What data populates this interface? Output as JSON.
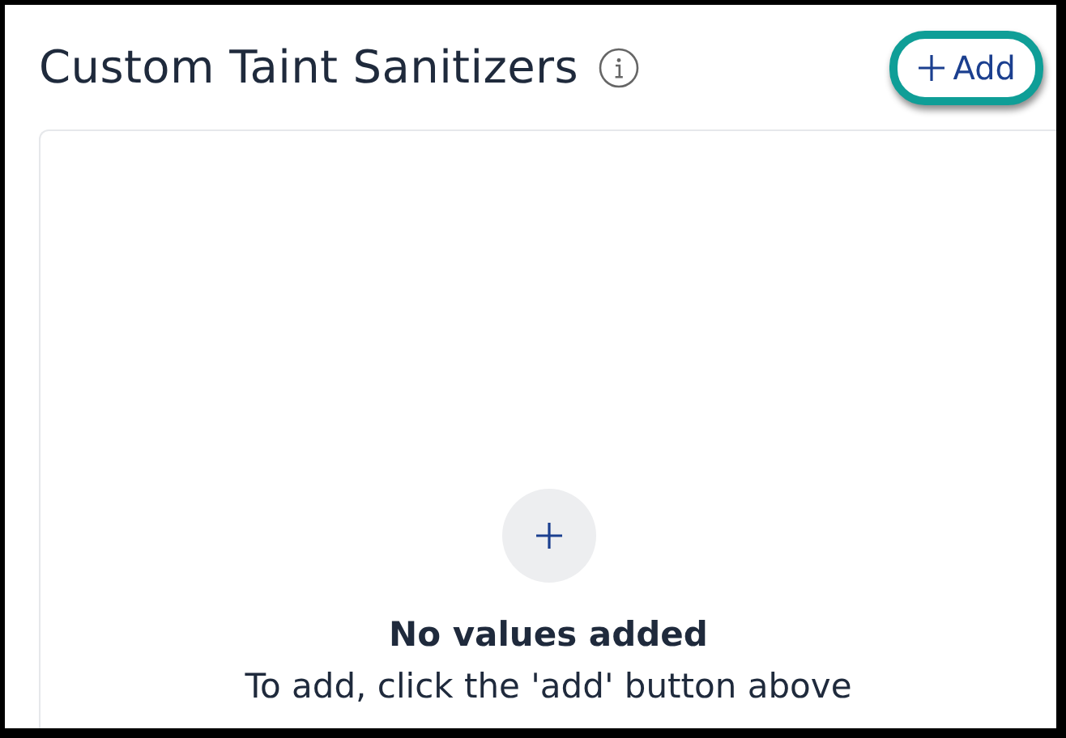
{
  "header": {
    "title": "Custom Taint Sanitizers",
    "add_button": {
      "label": "Add"
    }
  },
  "empty_state": {
    "heading": "No values added",
    "message": "To add, click the 'add' button above"
  }
}
